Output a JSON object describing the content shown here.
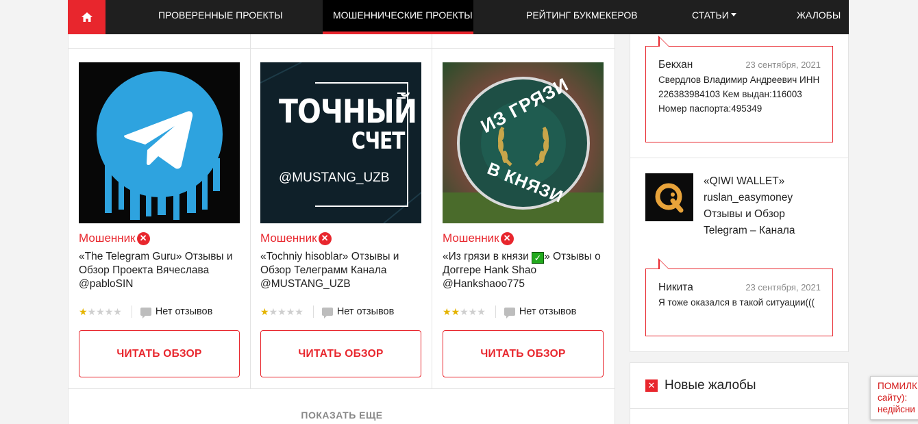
{
  "nav": {
    "items": [
      {
        "label": "ПРОВЕРЕННЫЕ ПРОЕКТЫ"
      },
      {
        "label": "МОШЕННИЧЕСКИЕ ПРОЕКТЫ"
      },
      {
        "label": "РЕЙТИНГ БУКМЕКЕРОВ"
      },
      {
        "label": "СТАТЬИ"
      },
      {
        "label": "ЖАЛОБЫ"
      }
    ],
    "active_index": 1,
    "home_icon": "home-icon"
  },
  "cards": [
    {
      "image_icon": "telegram-logo",
      "status": "Мошенник",
      "title": "«The Telegram Guru» Отзывы и Обзор Проекта Вячеслава @pabloSIN",
      "rating": 1,
      "reviews": "Нет отзывов",
      "button": "ЧИТАТЬ ОБЗОР"
    },
    {
      "image_icon": "tochny-schet-banner",
      "image_line1": "ТОЧНЫЙ",
      "image_line2": "СЧЕТ",
      "image_handle": "@MUSTANG_UZB",
      "status": "Мошенник",
      "title": "«Tochniy hisoblar» Отзывы и Обзор Телеграмм Канала @MUSTANG_UZB",
      "rating": 1,
      "reviews": "Нет отзывов",
      "button": "ЧИТАТЬ ОБЗОР"
    },
    {
      "image_icon": "laurel-wreath-emblem",
      "image_top": "ИЗ ГРЯЗИ",
      "image_bottom": "В КНЯЗИ",
      "status": "Мошенник",
      "title_part1": "«Из грязи в князи ",
      "title_part2": "» Отзывы о Доггере Hank Shao @Hankshaoo775",
      "rating": 2,
      "reviews": "Нет отзывов",
      "button": "ЧИТАТЬ ОБЗОР"
    }
  ],
  "show_more": "ПОКАЗАТЬ ЕЩЕ",
  "sidebar": {
    "comments": [
      {
        "name": "Бекхан",
        "date": "23 сентября, 2021",
        "text": "Свердлов Владимир Андреевич ИНН 226383984103 Кем выдан:116003 Номер паспорта:495349"
      },
      {
        "name": "Никита",
        "date": "23 сентября, 2021",
        "text": "Я тоже оказался в такой ситуации((("
      }
    ],
    "project": {
      "logo_icon": "qiwi-logo",
      "title": "«QIWI WALLET» ruslan_easymoney Отзывы и Обзор Telegram – Канала"
    },
    "complaints_title": "Новые жалобы"
  },
  "toast": {
    "line1": "ПОМИЛК",
    "line2": "сайту):",
    "line3": "недійсни"
  },
  "colors": {
    "accent": "#e8262d",
    "nav_bg": "#1f1f1f",
    "star": "#e5b400"
  }
}
